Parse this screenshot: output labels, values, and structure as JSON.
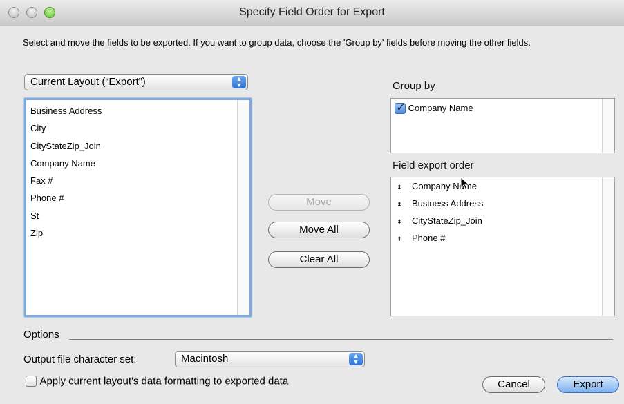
{
  "window": {
    "title": "Specify Field Order for Export"
  },
  "instructions": "Select and move the fields to be exported.  If you want to group data, choose the 'Group by' fields before moving the other fields.",
  "layout_select": {
    "value": "Current Layout (“Export”)"
  },
  "field_list": [
    "Business Address",
    "City",
    "CityStateZip_Join",
    "Company Name",
    "Fax #",
    "Phone #",
    "St",
    "Zip"
  ],
  "buttons": {
    "move": "Move",
    "move_all": "Move All",
    "clear_all": "Clear All",
    "cancel": "Cancel",
    "export": "Export"
  },
  "group_by": {
    "heading": "Group by",
    "items": [
      {
        "label": "Company Name",
        "checked": true
      }
    ]
  },
  "export_order": {
    "heading": "Field export order",
    "items": [
      "Company Name",
      "Business Address",
      "CityStateZip_Join",
      "Phone #"
    ]
  },
  "options": {
    "heading": "Options",
    "charset_label": "Output file character set:",
    "charset_value": "Macintosh",
    "apply_formatting_label": "Apply current layout's data formatting to exported data",
    "apply_formatting_checked": false
  }
}
